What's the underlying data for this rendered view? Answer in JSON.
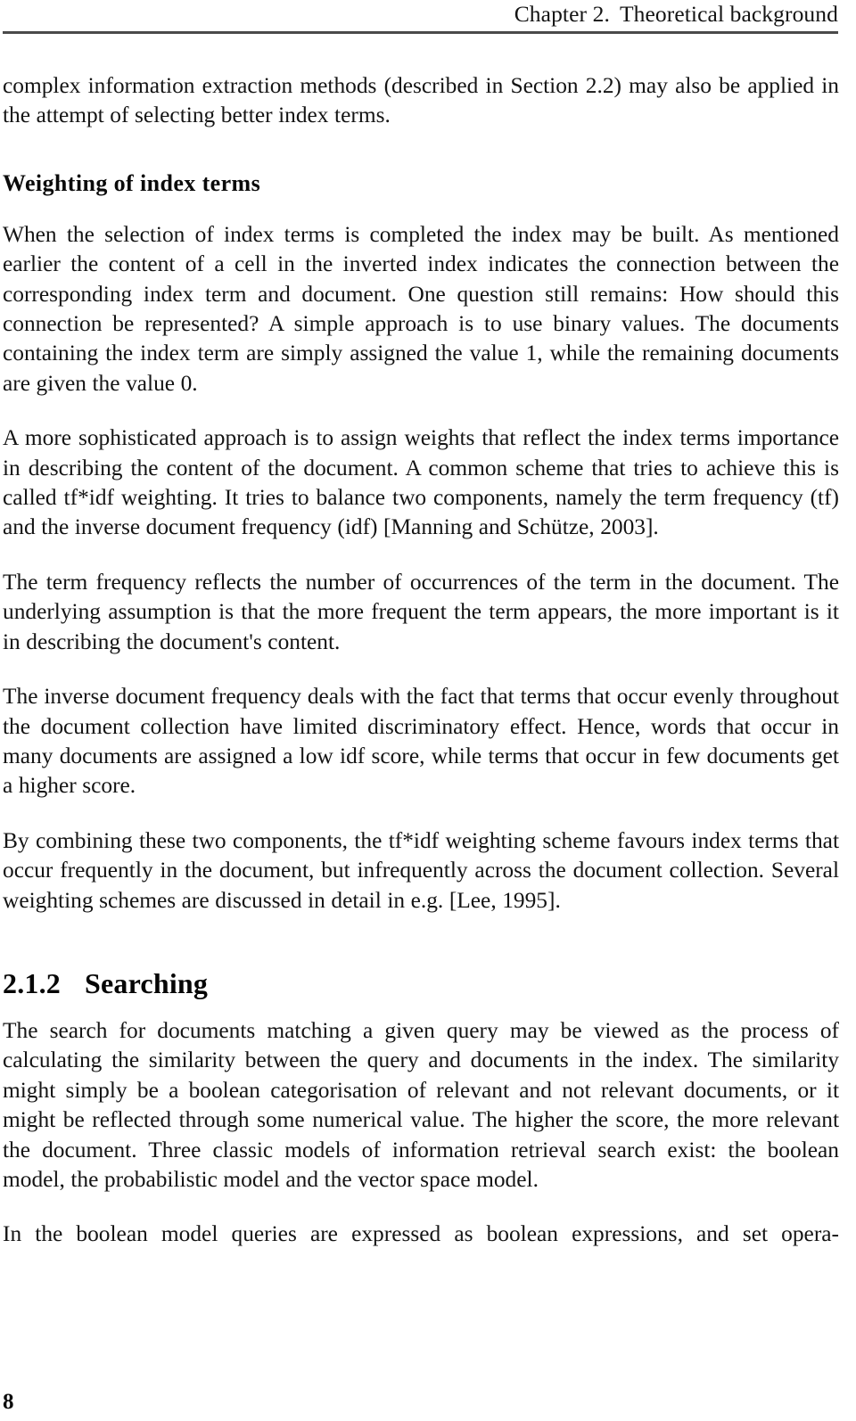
{
  "page": {
    "number": "8",
    "running_head": {
      "chapter": "Chapter 2.",
      "title": "Theoretical background"
    }
  },
  "content": {
    "continued_paragraph": "complex information extraction methods (described in Section 2.2) may also be applied in the attempt of selecting better index terms.",
    "subsection": {
      "heading": "Weighting of index terms",
      "paragraphs": [
        "When the selection of index terms is completed the index may be built. As mentioned earlier the content of a cell in the inverted index indicates the connection between the corresponding index term and document. One question still remains: How should this connection be represented? A simple approach is to use binary values. The documents containing the index term are simply assigned the value 1, while the remaining documents are given the value 0.",
        "A more sophisticated approach is to assign weights that reflect the index terms importance in describing the content of the document. A common scheme that tries to achieve this is called tf*idf weighting. It tries to balance two components, namely the term frequency (tf) and the inverse document frequency (idf) [Manning and Schütze, 2003].",
        "The term frequency reflects the number of occurrences of the term in the document. The underlying assumption is that the more frequent the term appears, the more important is it in describing the document's content.",
        "The inverse document frequency deals with the fact that terms that occur evenly throughout the document collection have limited discriminatory effect. Hence, words that occur in many documents are assigned a low idf score, while terms that occur in few documents get a higher score.",
        "By combining these two components, the tf*idf weighting scheme favours index terms that occur frequently in the document, but infrequently across the document collection. Several weighting schemes are discussed in detail in e.g. [Lee, 1995]."
      ]
    },
    "section": {
      "number": "2.1.2",
      "heading": "Searching",
      "paragraphs": [
        "The search for documents matching a given query may be viewed as the process of calculating the similarity between the query and documents in the index. The similarity might simply be a boolean categorisation of relevant and not relevant documents, or it might be reflected through some numerical value. The higher the score, the more relevant the document. Three classic models of information retrieval search exist: the boolean model, the probabilistic model and the vector space model.",
        "In the boolean model queries are expressed as boolean expressions, and set opera-"
      ]
    }
  },
  "colors": {
    "text": "#141414",
    "rule": "#4a4a4a",
    "background": "#ffffff"
  }
}
